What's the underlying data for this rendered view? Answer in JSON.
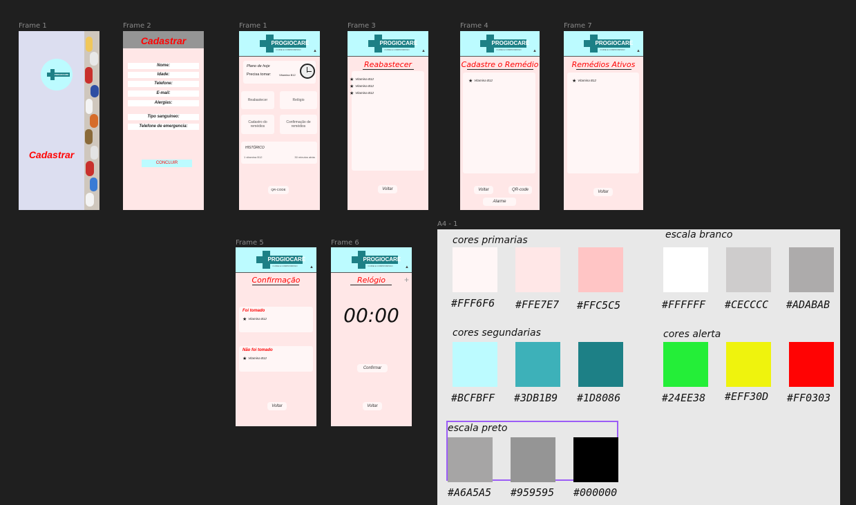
{
  "frames": {
    "f1a": {
      "label": "Frame 1",
      "cadastrar": "Cadastrar"
    },
    "f2": {
      "label": "Frame 2",
      "title": "Cadastrar",
      "fields": [
        "Nome:",
        "Idade:",
        "Telefone:",
        "E-mail:",
        "Alergias:",
        "Tipo sanguineo:",
        "Telefone de emergencia:"
      ],
      "conclude": "CONCLUIR"
    },
    "f1b": {
      "label": "Frame 1",
      "plano": "Plano de hoje",
      "precisa": "Precisa tomar:",
      "med": "Vitamina B12",
      "cards": [
        "Reabastecer",
        "Relógio",
        "Cadastro do remédios",
        "Confirmação de remédios"
      ],
      "hist_title": "HISTÓRICO",
      "hist_item": "1 vitamina B12",
      "hist_time": "30 minutos atrás",
      "qr": "QR-CODE"
    },
    "f3": {
      "label": "Frame 3",
      "title": "Reabastecer",
      "items": [
        "Vitamina B12",
        "Vitamina B12",
        "Vitamina B12"
      ],
      "back": "Voltar"
    },
    "f4": {
      "label": "Frame 4",
      "title": "Cadastre o Remédio",
      "items": [
        "Vitamina B12"
      ],
      "back": "Voltar",
      "qr": "QR-code",
      "alarm": "Alarme"
    },
    "f7": {
      "label": "Frame 7",
      "title": "Remédios Ativos",
      "items": [
        "Vitamina B12"
      ],
      "back": "Voltar"
    },
    "f5": {
      "label": "Frame 5",
      "title": "Confirmação",
      "taken": "Foi tomado",
      "taken_item": "Vitamina B12",
      "not_taken": "Não foi tomado",
      "not_taken_item": "Vitamina B12",
      "back": "Voltar"
    },
    "f6": {
      "label": "Frame 6",
      "title": "Relógio",
      "plus": "+",
      "time": "00:00",
      "confirm": "Confirmar",
      "back": "Voltar"
    }
  },
  "brand": {
    "name": "PROGIOCARE",
    "tag": "CUIDE E COMPROMISSO"
  },
  "palette": {
    "label": "A4 - 1",
    "primarias": {
      "title": "cores primarias",
      "colors": [
        "#FFF6F6",
        "#FFE7E7",
        "#FFC5C5"
      ]
    },
    "branco": {
      "title": "escala branco",
      "colors": [
        "#FFFFFF",
        "#CECCCC",
        "#ADABAB"
      ]
    },
    "segundarias": {
      "title": "cores segundarias",
      "colors": [
        "#BCFBFF",
        "#3DB1B9",
        "#1D8086"
      ]
    },
    "alerta": {
      "title": "cores alerta",
      "colors": [
        "#24EE38",
        "#EFF30D",
        "#FF0303"
      ]
    },
    "preto": {
      "title": "escala preto",
      "colors": [
        "#A6A5A5",
        "#959595",
        "#000000"
      ]
    }
  }
}
